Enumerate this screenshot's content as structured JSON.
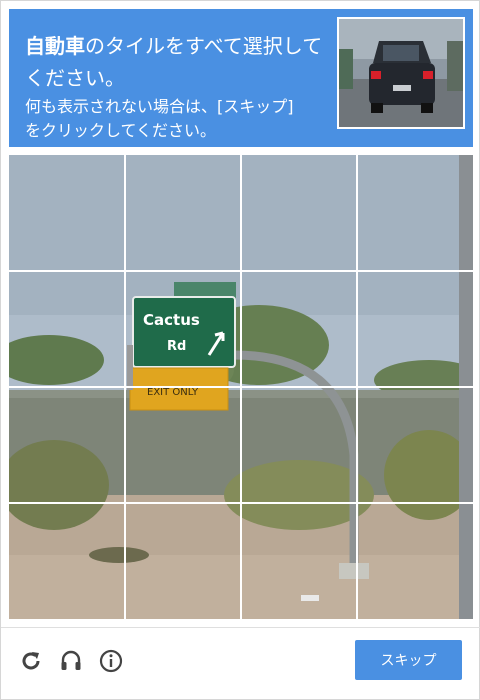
{
  "header": {
    "title_bold": "自動車",
    "title_rest": "のタイルをすべて選択して",
    "title_line2": "ください。",
    "sub_line1": "何も表示されない場合は、[スキップ]",
    "sub_line2": "をクリックしてください。"
  },
  "example_image": {
    "subject": "car rear view"
  },
  "grid": {
    "rows": 4,
    "cols": 4,
    "sign": {
      "line1": "Cactus",
      "line2": "Rd",
      "exit": "EXIT ONLY"
    }
  },
  "footer": {
    "icons": [
      "reload-icon",
      "audio-icon",
      "info-icon"
    ],
    "skip_label": "スキップ"
  },
  "colors": {
    "accent": "#4a90e2",
    "sign_green": "#1f6b4a",
    "sign_yellow": "#e0a51f"
  }
}
